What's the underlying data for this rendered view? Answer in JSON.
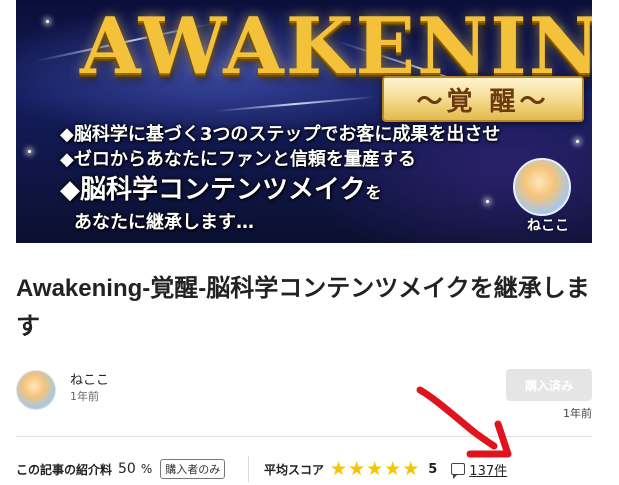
{
  "banner": {
    "title": "AWAKENING",
    "subtitle": "～覚 醒～",
    "line1": "◆脳科学に基づく3つのステップでお客に成果を出させ",
    "line2": "◆ゼロからあなたにファンと信頼を量産する",
    "line3_main": "◆脳科学コンテンツメイク",
    "line3_suffix": "を",
    "line4": "あなたに継承します…",
    "avatar_label": "ねここ"
  },
  "article": {
    "title": "Awakening-覚醒-脳科学コンテンツメイクを継承します"
  },
  "author": {
    "name": "ねここ",
    "posted": "1年前"
  },
  "purchase": {
    "button_label": "購入済み",
    "time": "1年前"
  },
  "stats": {
    "fee_label": "この記事の紹介料",
    "fee_value": "50",
    "fee_unit": "%",
    "buyer_badge": "購入者のみ",
    "score_label": "平均スコア",
    "stars": 5,
    "score_value": "5",
    "review_count": "137件"
  },
  "colors": {
    "star": "#f5c600",
    "annotation_arrow": "#e0141e",
    "button_disabled": "#e5e5e5"
  }
}
